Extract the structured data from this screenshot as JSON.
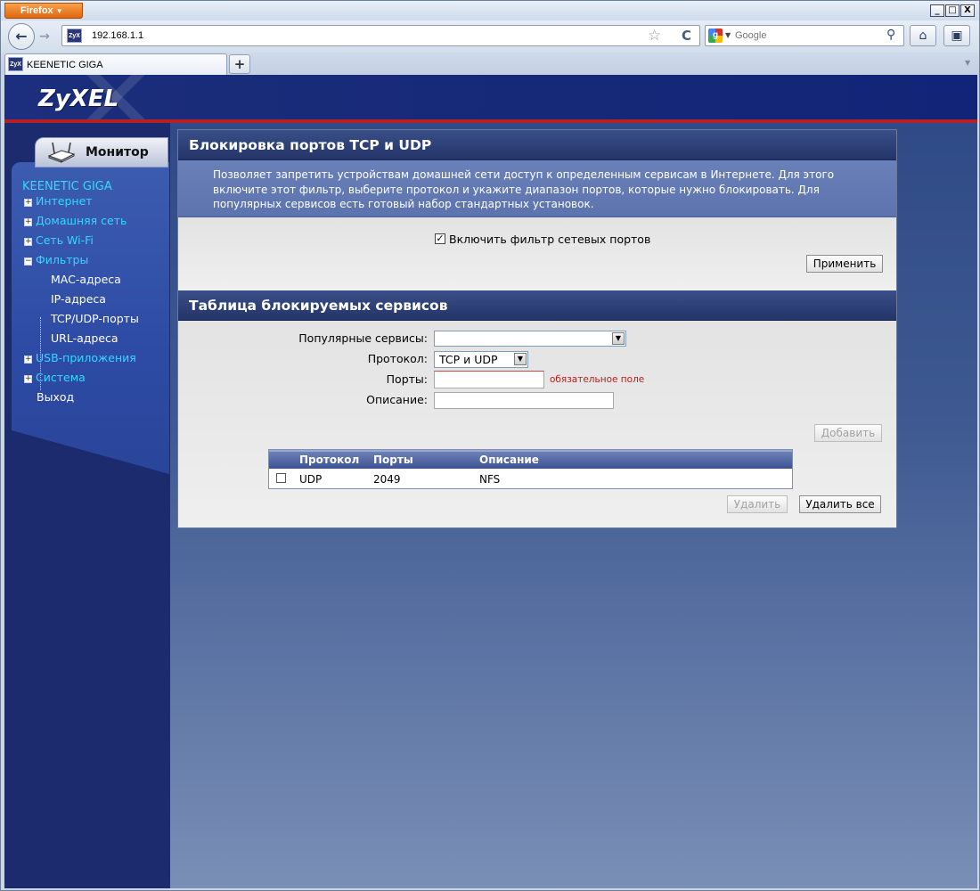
{
  "browser": {
    "menu_label": "Firefox",
    "url": "192.168.1.1",
    "search_placeholder": "Google",
    "tab_title": "KEENETIC GIGA",
    "site_icon_text": "ZyX",
    "window_controls": {
      "minimize": "_",
      "maximize": "□",
      "close": "X"
    }
  },
  "header": {
    "logo": "ZyXEL"
  },
  "sidebar": {
    "monitor_label": "Монитор",
    "device_name": "KEENETIC GIGA",
    "items": [
      {
        "label": "Интернет",
        "expandable": true
      },
      {
        "label": "Домашняя сеть",
        "expandable": true
      },
      {
        "label": "Сеть Wi-Fi",
        "expandable": true
      },
      {
        "label": "Фильтры",
        "expandable": true
      },
      {
        "label": "USB-приложения",
        "expandable": true
      },
      {
        "label": "Система",
        "expandable": true
      },
      {
        "label": "Выход",
        "expandable": false
      }
    ],
    "filter_subitems": [
      "MAC-адреса",
      "IP-адреса",
      "TCP/UDP-порты",
      "URL-адреса"
    ]
  },
  "port_block": {
    "title": "Блокировка портов TCP и UDP",
    "description": "Позволяет запретить устройствам домашней сети доступ к определенным сервисам в Интернете. Для этого включите этот фильтр, выберите протокол и укажите диапазон портов, которые нужно блокировать. Для популярных сервисов есть готовый набор стандартных установок.",
    "enable_label": "Включить фильтр сетевых портов",
    "enable_checked": true,
    "apply_label": "Применить"
  },
  "services": {
    "title": "Таблица блокируемых сервисов",
    "popular_label": "Популярные сервисы:",
    "popular_value": "",
    "protocol_label": "Протокол:",
    "protocol_value": "TCP и UDP",
    "ports_label": "Порты:",
    "ports_value": "",
    "required_note": "обязательное поле",
    "description_label": "Описание:",
    "description_value": "",
    "add_label": "Добавить",
    "table": {
      "columns": [
        "Протокол",
        "Порты",
        "Описание"
      ],
      "rows": [
        {
          "protocol": "UDP",
          "ports": "2049",
          "description": "NFS",
          "checked": false
        }
      ]
    },
    "delete_label": "Удалить",
    "delete_all_label": "Удалить все"
  }
}
